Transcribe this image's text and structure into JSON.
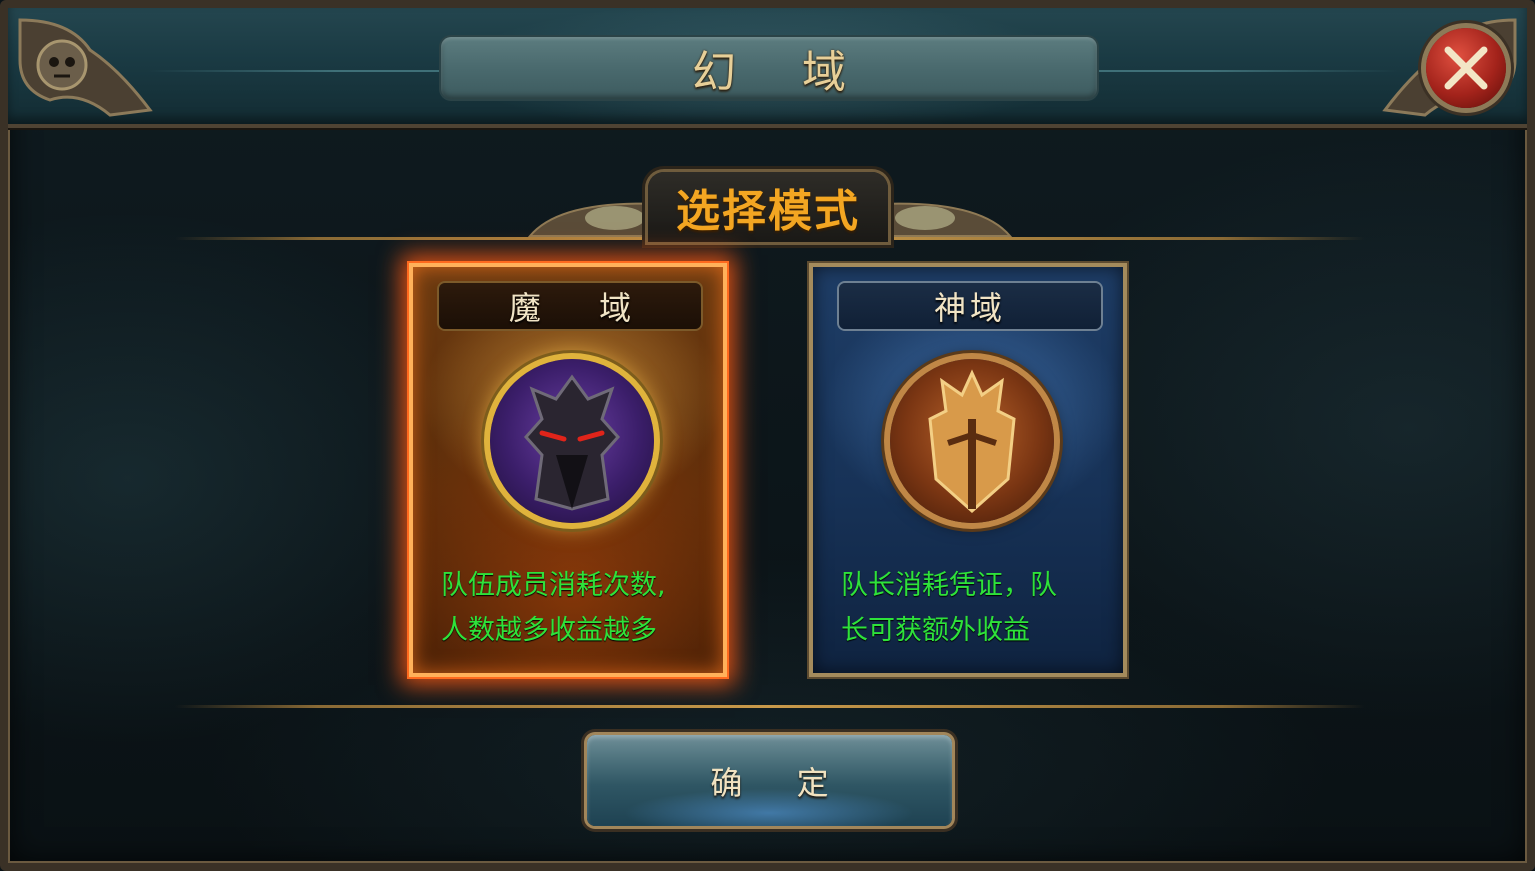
{
  "header": {
    "title": "幻 域"
  },
  "close_button": {
    "icon": "close-x-icon"
  },
  "section": {
    "title": "选择模式"
  },
  "modes": [
    {
      "name": "魔 域",
      "emblem_icon": "demon-helmet-icon",
      "desc_line1": "队伍成员消耗次数,",
      "desc_line2": "人数越多收益越多",
      "selected": true,
      "theme_color": "#ff6a1e"
    },
    {
      "name": "神域",
      "emblem_icon": "golden-knight-helmet-icon",
      "desc_line1": "队长消耗凭证，队",
      "desc_line2": "长可获额外收益",
      "selected": false,
      "theme_color": "#1e3d66"
    }
  ],
  "confirm": {
    "label": "确 定"
  },
  "colors": {
    "desc_text": "#2ee23a",
    "section_title": "#f3a622",
    "header_title": "#e7cf98"
  }
}
